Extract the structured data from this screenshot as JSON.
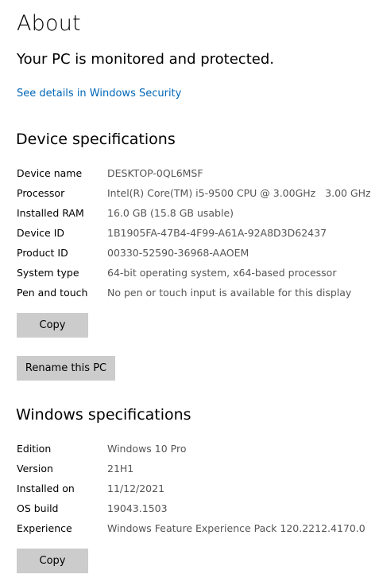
{
  "page": {
    "title": "About",
    "security_status": "Your PC is monitored and protected.",
    "security_link": "See details in Windows Security"
  },
  "device_specs": {
    "heading": "Device specifications",
    "rows": [
      {
        "label": "Device name",
        "value": "DESKTOP-0QL6MSF"
      },
      {
        "label": "Processor",
        "value": "Intel(R) Core(TM) i5-9500 CPU @ 3.00GHz   3.00 GHz"
      },
      {
        "label": "Installed RAM",
        "value": "16.0 GB (15.8 GB usable)"
      },
      {
        "label": "Device ID",
        "value": "1B1905FA-47B4-4F99-A61A-92A8D3D62437"
      },
      {
        "label": "Product ID",
        "value": "00330-52590-36968-AAOEM"
      },
      {
        "label": "System type",
        "value": "64-bit operating system, x64-based processor"
      },
      {
        "label": "Pen and touch",
        "value": "No pen or touch input is available for this display"
      }
    ],
    "copy_label": "Copy",
    "rename_label": "Rename this PC"
  },
  "windows_specs": {
    "heading": "Windows specifications",
    "rows": [
      {
        "label": "Edition",
        "value": "Windows 10 Pro"
      },
      {
        "label": "Version",
        "value": "21H1"
      },
      {
        "label": "Installed on",
        "value": "11/12/2021"
      },
      {
        "label": "OS build",
        "value": "19043.1503"
      },
      {
        "label": "Experience",
        "value": "Windows Feature Experience Pack 120.2212.4170.0"
      }
    ],
    "copy_label": "Copy"
  },
  "colors": {
    "link": "#0067b8",
    "button": "#cccccc",
    "value_text": "#555555"
  }
}
